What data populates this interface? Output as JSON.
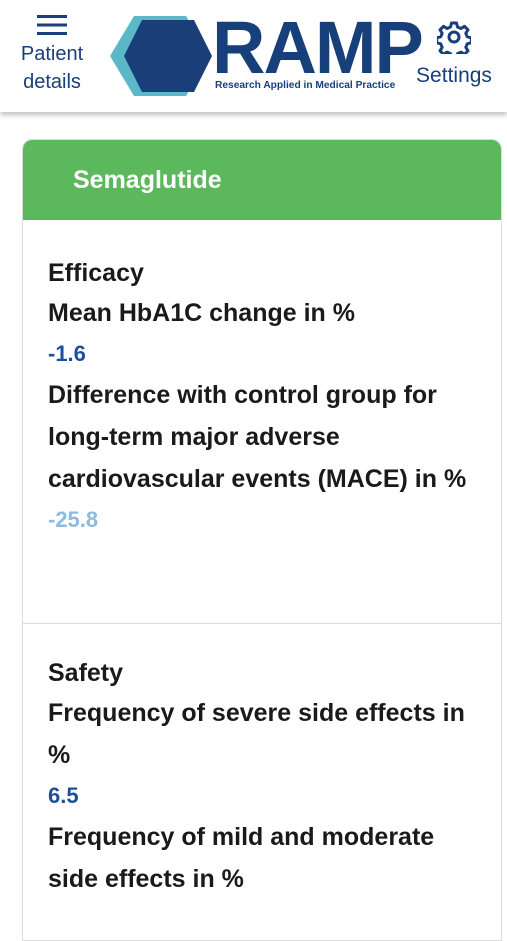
{
  "header": {
    "menu_label": "Patient details",
    "menu_label_line1": "Patient",
    "menu_label_line2": "details",
    "logo_text": "RAMP",
    "logo_tagline": "Research Applied in Medical Practice",
    "settings_label": "Settings",
    "icons": {
      "menu": "hamburger-menu-icon",
      "settings": "gear-icon",
      "logo": "hexagon-logo-icon"
    }
  },
  "colors": {
    "brand_blue": "#173f7a",
    "card_header_green": "#5cb85c",
    "value_dark_blue": "#1d4f9c",
    "value_light_blue": "#8fbadf"
  },
  "card": {
    "title": "Semaglutide",
    "efficacy": {
      "title": "Efficacy",
      "metrics": [
        {
          "label": "Mean HbA1C change in %",
          "value": "-1.6"
        },
        {
          "label": "Difference with control group for long-term major adverse cardiovascular events (MACE) in %",
          "value": "-25.8"
        }
      ]
    },
    "safety": {
      "title": "Safety",
      "metrics": [
        {
          "label": "Frequency of severe side effects in %",
          "value": "6.5"
        },
        {
          "label": "Frequency of mild and moderate side effects in %",
          "value": ""
        }
      ]
    }
  }
}
